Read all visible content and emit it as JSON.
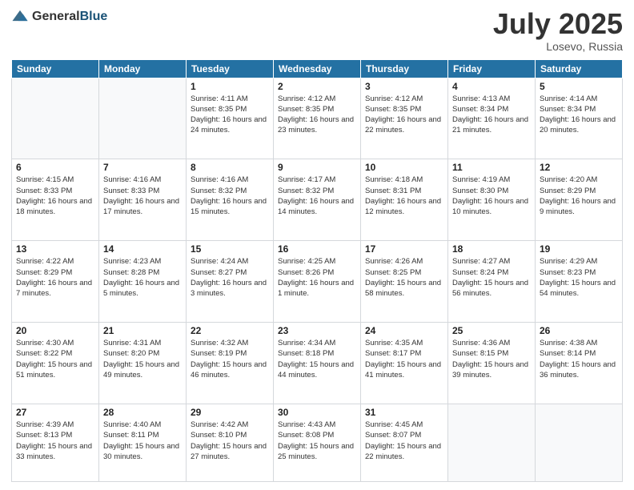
{
  "header": {
    "logo_general": "General",
    "logo_blue": "Blue",
    "month": "July 2025",
    "location": "Losevo, Russia"
  },
  "weekdays": [
    "Sunday",
    "Monday",
    "Tuesday",
    "Wednesday",
    "Thursday",
    "Friday",
    "Saturday"
  ],
  "weeks": [
    [
      {
        "day": "",
        "info": ""
      },
      {
        "day": "",
        "info": ""
      },
      {
        "day": "1",
        "info": "Sunrise: 4:11 AM\nSunset: 8:35 PM\nDaylight: 16 hours and 24 minutes."
      },
      {
        "day": "2",
        "info": "Sunrise: 4:12 AM\nSunset: 8:35 PM\nDaylight: 16 hours and 23 minutes."
      },
      {
        "day": "3",
        "info": "Sunrise: 4:12 AM\nSunset: 8:35 PM\nDaylight: 16 hours and 22 minutes."
      },
      {
        "day": "4",
        "info": "Sunrise: 4:13 AM\nSunset: 8:34 PM\nDaylight: 16 hours and 21 minutes."
      },
      {
        "day": "5",
        "info": "Sunrise: 4:14 AM\nSunset: 8:34 PM\nDaylight: 16 hours and 20 minutes."
      }
    ],
    [
      {
        "day": "6",
        "info": "Sunrise: 4:15 AM\nSunset: 8:33 PM\nDaylight: 16 hours and 18 minutes."
      },
      {
        "day": "7",
        "info": "Sunrise: 4:16 AM\nSunset: 8:33 PM\nDaylight: 16 hours and 17 minutes."
      },
      {
        "day": "8",
        "info": "Sunrise: 4:16 AM\nSunset: 8:32 PM\nDaylight: 16 hours and 15 minutes."
      },
      {
        "day": "9",
        "info": "Sunrise: 4:17 AM\nSunset: 8:32 PM\nDaylight: 16 hours and 14 minutes."
      },
      {
        "day": "10",
        "info": "Sunrise: 4:18 AM\nSunset: 8:31 PM\nDaylight: 16 hours and 12 minutes."
      },
      {
        "day": "11",
        "info": "Sunrise: 4:19 AM\nSunset: 8:30 PM\nDaylight: 16 hours and 10 minutes."
      },
      {
        "day": "12",
        "info": "Sunrise: 4:20 AM\nSunset: 8:29 PM\nDaylight: 16 hours and 9 minutes."
      }
    ],
    [
      {
        "day": "13",
        "info": "Sunrise: 4:22 AM\nSunset: 8:29 PM\nDaylight: 16 hours and 7 minutes."
      },
      {
        "day": "14",
        "info": "Sunrise: 4:23 AM\nSunset: 8:28 PM\nDaylight: 16 hours and 5 minutes."
      },
      {
        "day": "15",
        "info": "Sunrise: 4:24 AM\nSunset: 8:27 PM\nDaylight: 16 hours and 3 minutes."
      },
      {
        "day": "16",
        "info": "Sunrise: 4:25 AM\nSunset: 8:26 PM\nDaylight: 16 hours and 1 minute."
      },
      {
        "day": "17",
        "info": "Sunrise: 4:26 AM\nSunset: 8:25 PM\nDaylight: 15 hours and 58 minutes."
      },
      {
        "day": "18",
        "info": "Sunrise: 4:27 AM\nSunset: 8:24 PM\nDaylight: 15 hours and 56 minutes."
      },
      {
        "day": "19",
        "info": "Sunrise: 4:29 AM\nSunset: 8:23 PM\nDaylight: 15 hours and 54 minutes."
      }
    ],
    [
      {
        "day": "20",
        "info": "Sunrise: 4:30 AM\nSunset: 8:22 PM\nDaylight: 15 hours and 51 minutes."
      },
      {
        "day": "21",
        "info": "Sunrise: 4:31 AM\nSunset: 8:20 PM\nDaylight: 15 hours and 49 minutes."
      },
      {
        "day": "22",
        "info": "Sunrise: 4:32 AM\nSunset: 8:19 PM\nDaylight: 15 hours and 46 minutes."
      },
      {
        "day": "23",
        "info": "Sunrise: 4:34 AM\nSunset: 8:18 PM\nDaylight: 15 hours and 44 minutes."
      },
      {
        "day": "24",
        "info": "Sunrise: 4:35 AM\nSunset: 8:17 PM\nDaylight: 15 hours and 41 minutes."
      },
      {
        "day": "25",
        "info": "Sunrise: 4:36 AM\nSunset: 8:15 PM\nDaylight: 15 hours and 39 minutes."
      },
      {
        "day": "26",
        "info": "Sunrise: 4:38 AM\nSunset: 8:14 PM\nDaylight: 15 hours and 36 minutes."
      }
    ],
    [
      {
        "day": "27",
        "info": "Sunrise: 4:39 AM\nSunset: 8:13 PM\nDaylight: 15 hours and 33 minutes."
      },
      {
        "day": "28",
        "info": "Sunrise: 4:40 AM\nSunset: 8:11 PM\nDaylight: 15 hours and 30 minutes."
      },
      {
        "day": "29",
        "info": "Sunrise: 4:42 AM\nSunset: 8:10 PM\nDaylight: 15 hours and 27 minutes."
      },
      {
        "day": "30",
        "info": "Sunrise: 4:43 AM\nSunset: 8:08 PM\nDaylight: 15 hours and 25 minutes."
      },
      {
        "day": "31",
        "info": "Sunrise: 4:45 AM\nSunset: 8:07 PM\nDaylight: 15 hours and 22 minutes."
      },
      {
        "day": "",
        "info": ""
      },
      {
        "day": "",
        "info": ""
      }
    ]
  ]
}
